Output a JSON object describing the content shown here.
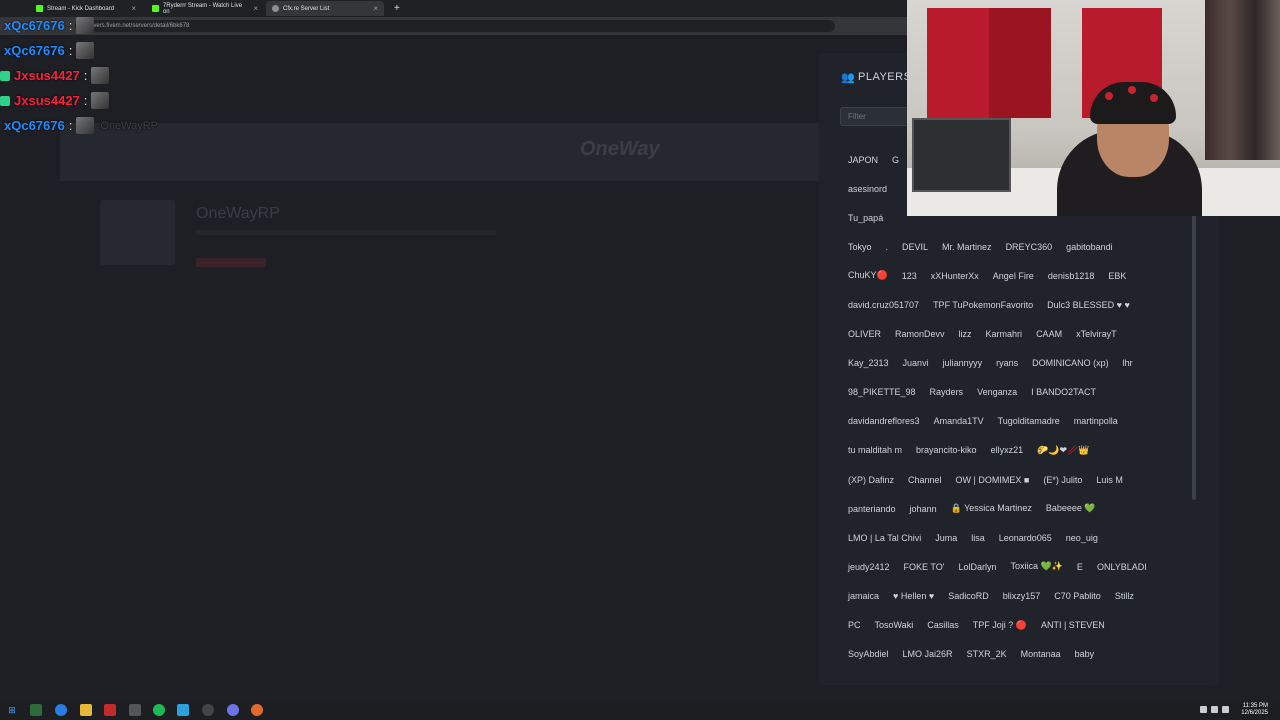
{
  "browser": {
    "tabs": [
      {
        "title": "Stream - Kick Dashboard",
        "color": "#53fc18"
      },
      {
        "title": "7Ryderrr Stream - Watch Live on",
        "color": "#53fc18"
      },
      {
        "title": "Cfx.re Server List",
        "color": "#8f8f8f"
      }
    ],
    "url": "servers.fivem.net/servers/detail/6bk678"
  },
  "server": {
    "name": "OneWayRP",
    "banner_logo": "OneWay"
  },
  "chat": [
    {
      "user": "xQc67676",
      "color": "#1e8cff",
      "badge": false,
      "ghost": ""
    },
    {
      "user": "xQc67676",
      "color": "#1e8cff",
      "badge": false,
      "ghost": ""
    },
    {
      "user": "Jxsus4427",
      "color": "#ff1f3d",
      "badge": true,
      "ghost": ""
    },
    {
      "user": "Jxsus4427",
      "color": "#ff1f3d",
      "badge": true,
      "ghost": ""
    },
    {
      "user": "xQc67676",
      "color": "#1e8cff",
      "badge": false,
      "ghost": "OneWayRP"
    }
  ],
  "players_panel": {
    "title": "PLAYERS",
    "filter_placeholder": "Filter",
    "rows": [
      [
        "JAPON",
        "G"
      ],
      [
        "asesinord"
      ],
      [
        "Tu_papá"
      ],
      [
        "Tokyo",
        ".",
        "DEVIL",
        "Mr. Martinez",
        "DREYC360",
        "gabitobandi"
      ],
      [
        "ChuKY🔴",
        "123",
        "xXHunterXx",
        "Angel Fire",
        "denisb1218",
        "EBK"
      ],
      [
        "david.cruz051707",
        "TPF TuPokemonFavorito",
        "Dulc3 BLESSED ♥ ♥"
      ],
      [
        "OLIVER",
        "RamonDevv",
        "lizz",
        "Karmahri",
        "CAAM",
        "xTelvirayT"
      ],
      [
        "Kay_2313",
        "Juanvi",
        "juliannyyy",
        "ryans",
        "DOMINICANO (xp)",
        "lhr"
      ],
      [
        "98_PIKETTE_98",
        "Rayders",
        "Venganza",
        "I BANDO2TACT"
      ],
      [
        "davidandreflores3",
        "Amanda1TV",
        "Tugolditamadre",
        "martinpolla"
      ],
      [
        "tu malditah m",
        "brayancito-kiko",
        "ellyxz21",
        "🌮🌙❤🥢👑"
      ],
      [
        "(XP) Dafinz",
        "Channel",
        "OW | DOMIMEX ■",
        "(E*) Julito",
        "Luis M"
      ],
      [
        "panteriando",
        "johann",
        "🔒 Yessica Martinez",
        "Babeeee 💚"
      ],
      [
        "LMO | La Tal Chivi",
        "Juma",
        "lisa",
        "Leonardo065",
        "neo_uig"
      ],
      [
        "jeudy2412",
        "FOKE TO'",
        "LolDarlyn",
        "Toxiica 💚✨",
        "E",
        "ONLYBLADI"
      ],
      [
        "jamaica",
        "♥ Hellen ♥",
        "SadicoRD",
        "blixzy157",
        "C70 Pablito",
        "Stillz"
      ],
      [
        "PC",
        "TosoWaki",
        "Casillas",
        "TPF Joji ? 🔴",
        "ANTI | STEVEN"
      ],
      [
        "SoyAbdiel",
        "LMO Jai26R",
        "STXR_2K",
        "Montanaa",
        "baby"
      ]
    ]
  },
  "taskbar": {
    "time": "11:35 PM",
    "date": "12/6/2025"
  }
}
